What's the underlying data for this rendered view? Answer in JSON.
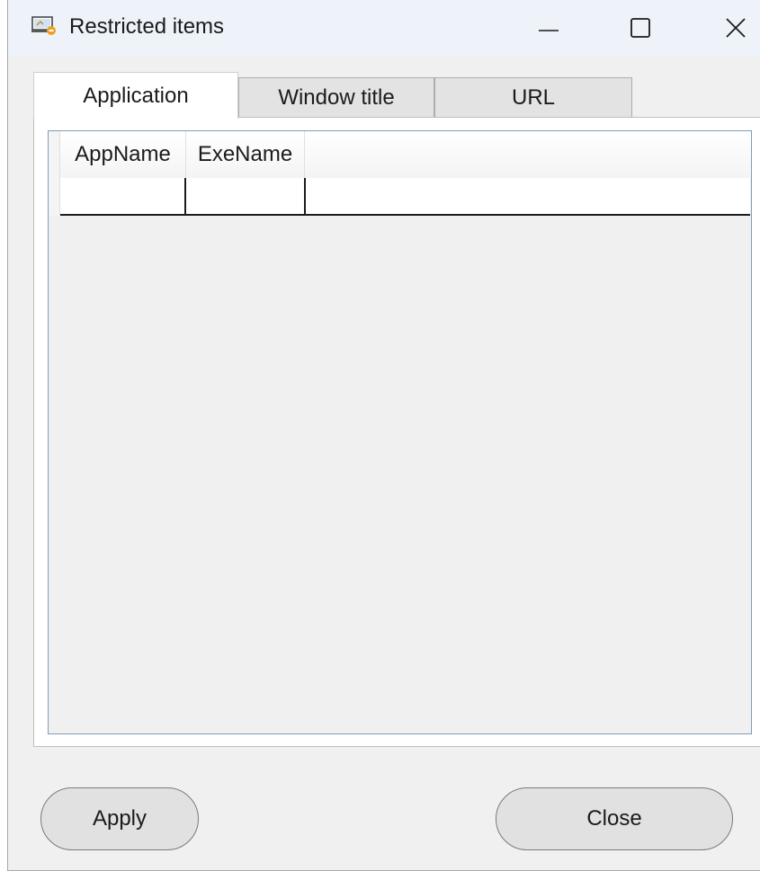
{
  "window": {
    "title": "Restricted items",
    "icon": "restricted-app-icon"
  },
  "caption_buttons": {
    "minimize_icon": "minimize-icon",
    "maximize_icon": "maximize-icon",
    "close_icon": "close-icon"
  },
  "tabs": [
    {
      "label": "Application",
      "active": true
    },
    {
      "label": "Window title",
      "active": false
    },
    {
      "label": "URL",
      "active": false
    }
  ],
  "grid": {
    "columns": [
      "AppName",
      "ExeName"
    ],
    "rows": [
      {
        "AppName": "",
        "ExeName": ""
      }
    ]
  },
  "buttons": {
    "apply_label": "Apply",
    "close_label": "Close"
  },
  "colors": {
    "titlebar": "#eef3f9",
    "window_bg": "#f0f0f0",
    "button_bg": "#e1e1e1",
    "grid_border": "#7f9db9"
  }
}
